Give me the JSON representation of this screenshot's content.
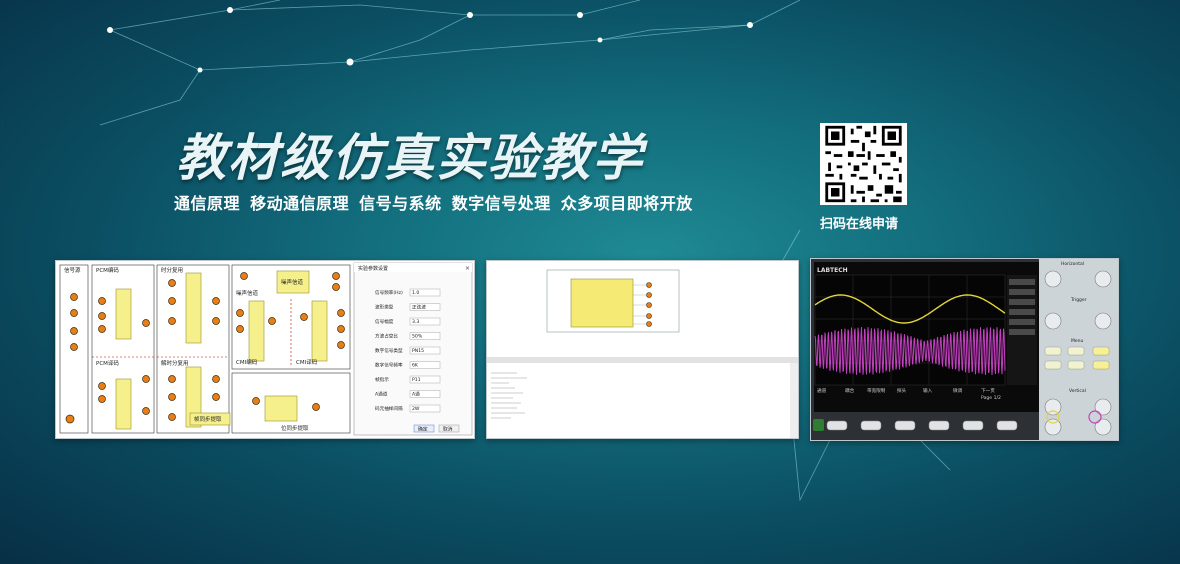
{
  "headline": "教材级仿真实验教学",
  "subtitle": "通信原理 移动通信原理    信号与系统 数字信号处理   众多项目即将开放",
  "qr_label": "扫码在线申请",
  "circuit": {
    "source_label": "信号源",
    "pcm_enc": "PCM编码",
    "pcm_dec": "PCM译码",
    "tdm": "时分复用",
    "tdm_demux": "解时分复用",
    "noise": "噪声信道",
    "noise_box": "噪声信道",
    "cmi_enc": "CMI编码",
    "cmi_dec": "CMI译码",
    "sync": "位同步提取",
    "frame_sync": "帧同步提取"
  },
  "dialog": {
    "title": "实验参数设置",
    "rows": [
      {
        "label": "信号频率(Hz)",
        "value": "1.0"
      },
      {
        "label": "波形类型",
        "value": "正弦波"
      },
      {
        "label": "信号幅度",
        "value": "3.3"
      },
      {
        "label": "方波占空比",
        "value": "50%"
      },
      {
        "label": "数字信号类型",
        "value": "PN15"
      },
      {
        "label": "数字信号频率",
        "value": "6K"
      },
      {
        "label": "帧指示",
        "value": "P11"
      },
      {
        "label": "A通道",
        "value": "A通"
      },
      {
        "label": "码元抽样间隔",
        "value": "2W"
      }
    ],
    "ok": "确定",
    "cancel": "取消"
  },
  "scope": {
    "brand": "LABTECH",
    "horizontal": "Horizontal",
    "trigger": "Trigger",
    "vertical": "Vertical",
    "menu": "Menu",
    "bottom_labels": [
      "耦合",
      "带宽限制",
      "探头",
      "输入",
      "微调",
      "反相",
      "下一页"
    ],
    "page": "Page 1/2"
  },
  "colors": {
    "wave1": "#e2d43a",
    "wave2": "#c23fbf",
    "accent": "#f7f094"
  }
}
